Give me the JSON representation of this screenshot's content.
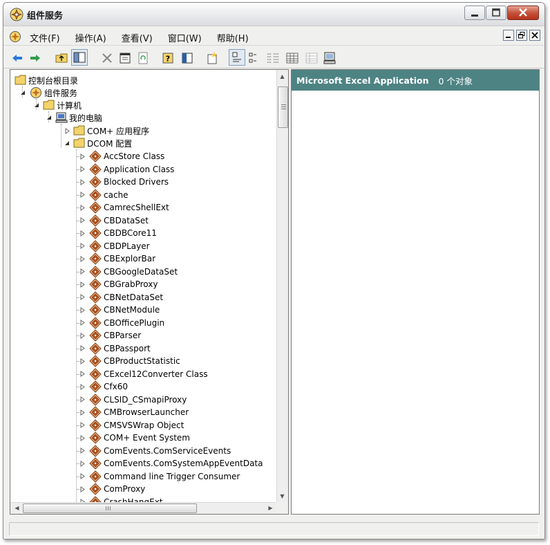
{
  "window": {
    "title": "组件服务"
  },
  "menu": {
    "items": [
      "文件(F)",
      "操作(A)",
      "查看(V)",
      "窗口(W)",
      "帮助(H)"
    ]
  },
  "toolbar": {
    "buttons": [
      "back-arrow-icon",
      "forward-arrow-icon",
      "up-folder-icon",
      "show-hide-tree-icon",
      "delete-icon",
      "properties-icon",
      "refresh-icon",
      "help-icon",
      "export-icon",
      "new-icon",
      "large-icons-icon",
      "small-icons-icon",
      "list-view-icon",
      "detail-view-icon",
      "status-view-icon",
      "computer-icon"
    ]
  },
  "tree": {
    "root": "控制台根目录",
    "component_services": "组件服务",
    "computers": "计算机",
    "my_computer": "我的电脑",
    "com_apps": "COM+ 应用程序",
    "dcom_config": "DCOM 配置",
    "dcom_items": [
      "AccStore Class",
      "Application Class",
      "Blocked Drivers",
      "cache",
      "CamrecShellExt",
      "CBDataSet",
      "CBDBCore11",
      "CBDPLayer",
      "CBExplorBar",
      "CBGoogleDataSet",
      "CBGrabProxy",
      "CBNetDataSet",
      "CBNetModule",
      "CBOfficePlugin",
      "CBParser",
      "CBPassport",
      "CBProductStatistic",
      "CExcel12Converter Class",
      "Cfx60",
      "CLSID_CSmapiProxy",
      "CMBrowserLauncher",
      "CMSVSWrap Object",
      "COM+ Event System",
      "ComEvents.ComServiceEvents",
      "ComEvents.ComSystemAppEventData",
      "Command line Trigger Consumer",
      "ComProxy",
      "CrashHangExt"
    ]
  },
  "right_pane": {
    "title": "Microsoft Excel Application",
    "count": "0 个对象"
  },
  "colors": {
    "header_bg": "#4e8383",
    "title_bar": "#e9eaec",
    "close_button": "#c7533c"
  }
}
